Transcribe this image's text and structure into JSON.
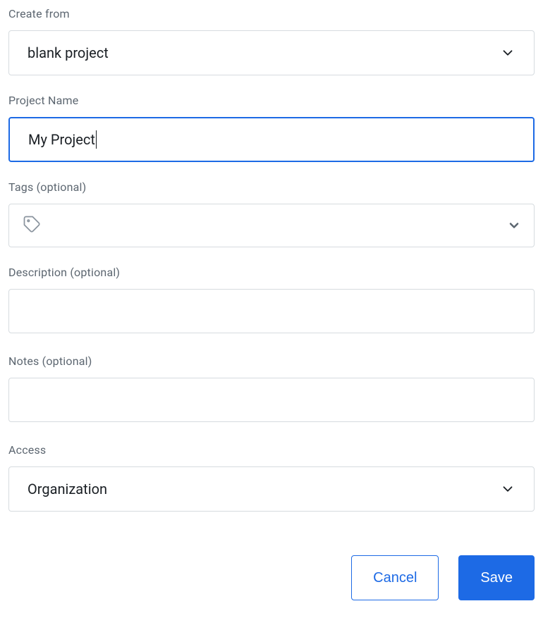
{
  "labels": {
    "create_from": "Create from",
    "project_name": "Project Name",
    "tags": "Tags (optional)",
    "description": "Description (optional)",
    "notes": "Notes (optional)",
    "access": "Access"
  },
  "values": {
    "create_from": "blank project",
    "project_name": "My Project",
    "tags": "",
    "description": "",
    "notes": "",
    "access": "Organization"
  },
  "buttons": {
    "cancel": "Cancel",
    "save": "Save"
  },
  "colors": {
    "accent": "#1d6ae5",
    "border": "#d6dbdf",
    "label": "#5c6670",
    "text": "#1a1f24"
  }
}
